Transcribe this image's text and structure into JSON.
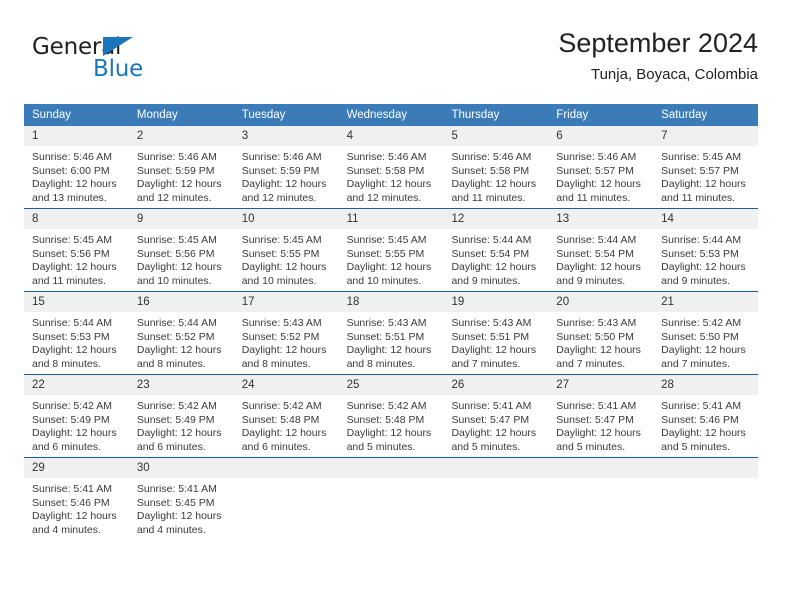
{
  "brand": {
    "name_dark": "General",
    "name_blue": "Blue",
    "accent_color": "#1b75bb"
  },
  "header": {
    "title": "September 2024",
    "subtitle": "Tunja, Boyaca, Colombia"
  },
  "calendar": {
    "header_bg": "#3b7cb8",
    "weekdays": [
      "Sunday",
      "Monday",
      "Tuesday",
      "Wednesday",
      "Thursday",
      "Friday",
      "Saturday"
    ],
    "weeks": [
      [
        {
          "day": "1",
          "sunrise": "Sunrise: 5:46 AM",
          "sunset": "Sunset: 6:00 PM",
          "daylight_1": "Daylight: 12 hours",
          "daylight_2": "and 13 minutes."
        },
        {
          "day": "2",
          "sunrise": "Sunrise: 5:46 AM",
          "sunset": "Sunset: 5:59 PM",
          "daylight_1": "Daylight: 12 hours",
          "daylight_2": "and 12 minutes."
        },
        {
          "day": "3",
          "sunrise": "Sunrise: 5:46 AM",
          "sunset": "Sunset: 5:59 PM",
          "daylight_1": "Daylight: 12 hours",
          "daylight_2": "and 12 minutes."
        },
        {
          "day": "4",
          "sunrise": "Sunrise: 5:46 AM",
          "sunset": "Sunset: 5:58 PM",
          "daylight_1": "Daylight: 12 hours",
          "daylight_2": "and 12 minutes."
        },
        {
          "day": "5",
          "sunrise": "Sunrise: 5:46 AM",
          "sunset": "Sunset: 5:58 PM",
          "daylight_1": "Daylight: 12 hours",
          "daylight_2": "and 11 minutes."
        },
        {
          "day": "6",
          "sunrise": "Sunrise: 5:46 AM",
          "sunset": "Sunset: 5:57 PM",
          "daylight_1": "Daylight: 12 hours",
          "daylight_2": "and 11 minutes."
        },
        {
          "day": "7",
          "sunrise": "Sunrise: 5:45 AM",
          "sunset": "Sunset: 5:57 PM",
          "daylight_1": "Daylight: 12 hours",
          "daylight_2": "and 11 minutes."
        }
      ],
      [
        {
          "day": "8",
          "sunrise": "Sunrise: 5:45 AM",
          "sunset": "Sunset: 5:56 PM",
          "daylight_1": "Daylight: 12 hours",
          "daylight_2": "and 11 minutes."
        },
        {
          "day": "9",
          "sunrise": "Sunrise: 5:45 AM",
          "sunset": "Sunset: 5:56 PM",
          "daylight_1": "Daylight: 12 hours",
          "daylight_2": "and 10 minutes."
        },
        {
          "day": "10",
          "sunrise": "Sunrise: 5:45 AM",
          "sunset": "Sunset: 5:55 PM",
          "daylight_1": "Daylight: 12 hours",
          "daylight_2": "and 10 minutes."
        },
        {
          "day": "11",
          "sunrise": "Sunrise: 5:45 AM",
          "sunset": "Sunset: 5:55 PM",
          "daylight_1": "Daylight: 12 hours",
          "daylight_2": "and 10 minutes."
        },
        {
          "day": "12",
          "sunrise": "Sunrise: 5:44 AM",
          "sunset": "Sunset: 5:54 PM",
          "daylight_1": "Daylight: 12 hours",
          "daylight_2": "and 9 minutes."
        },
        {
          "day": "13",
          "sunrise": "Sunrise: 5:44 AM",
          "sunset": "Sunset: 5:54 PM",
          "daylight_1": "Daylight: 12 hours",
          "daylight_2": "and 9 minutes."
        },
        {
          "day": "14",
          "sunrise": "Sunrise: 5:44 AM",
          "sunset": "Sunset: 5:53 PM",
          "daylight_1": "Daylight: 12 hours",
          "daylight_2": "and 9 minutes."
        }
      ],
      [
        {
          "day": "15",
          "sunrise": "Sunrise: 5:44 AM",
          "sunset": "Sunset: 5:53 PM",
          "daylight_1": "Daylight: 12 hours",
          "daylight_2": "and 8 minutes."
        },
        {
          "day": "16",
          "sunrise": "Sunrise: 5:44 AM",
          "sunset": "Sunset: 5:52 PM",
          "daylight_1": "Daylight: 12 hours",
          "daylight_2": "and 8 minutes."
        },
        {
          "day": "17",
          "sunrise": "Sunrise: 5:43 AM",
          "sunset": "Sunset: 5:52 PM",
          "daylight_1": "Daylight: 12 hours",
          "daylight_2": "and 8 minutes."
        },
        {
          "day": "18",
          "sunrise": "Sunrise: 5:43 AM",
          "sunset": "Sunset: 5:51 PM",
          "daylight_1": "Daylight: 12 hours",
          "daylight_2": "and 8 minutes."
        },
        {
          "day": "19",
          "sunrise": "Sunrise: 5:43 AM",
          "sunset": "Sunset: 5:51 PM",
          "daylight_1": "Daylight: 12 hours",
          "daylight_2": "and 7 minutes."
        },
        {
          "day": "20",
          "sunrise": "Sunrise: 5:43 AM",
          "sunset": "Sunset: 5:50 PM",
          "daylight_1": "Daylight: 12 hours",
          "daylight_2": "and 7 minutes."
        },
        {
          "day": "21",
          "sunrise": "Sunrise: 5:42 AM",
          "sunset": "Sunset: 5:50 PM",
          "daylight_1": "Daylight: 12 hours",
          "daylight_2": "and 7 minutes."
        }
      ],
      [
        {
          "day": "22",
          "sunrise": "Sunrise: 5:42 AM",
          "sunset": "Sunset: 5:49 PM",
          "daylight_1": "Daylight: 12 hours",
          "daylight_2": "and 6 minutes."
        },
        {
          "day": "23",
          "sunrise": "Sunrise: 5:42 AM",
          "sunset": "Sunset: 5:49 PM",
          "daylight_1": "Daylight: 12 hours",
          "daylight_2": "and 6 minutes."
        },
        {
          "day": "24",
          "sunrise": "Sunrise: 5:42 AM",
          "sunset": "Sunset: 5:48 PM",
          "daylight_1": "Daylight: 12 hours",
          "daylight_2": "and 6 minutes."
        },
        {
          "day": "25",
          "sunrise": "Sunrise: 5:42 AM",
          "sunset": "Sunset: 5:48 PM",
          "daylight_1": "Daylight: 12 hours",
          "daylight_2": "and 5 minutes."
        },
        {
          "day": "26",
          "sunrise": "Sunrise: 5:41 AM",
          "sunset": "Sunset: 5:47 PM",
          "daylight_1": "Daylight: 12 hours",
          "daylight_2": "and 5 minutes."
        },
        {
          "day": "27",
          "sunrise": "Sunrise: 5:41 AM",
          "sunset": "Sunset: 5:47 PM",
          "daylight_1": "Daylight: 12 hours",
          "daylight_2": "and 5 minutes."
        },
        {
          "day": "28",
          "sunrise": "Sunrise: 5:41 AM",
          "sunset": "Sunset: 5:46 PM",
          "daylight_1": "Daylight: 12 hours",
          "daylight_2": "and 5 minutes."
        }
      ],
      [
        {
          "day": "29",
          "sunrise": "Sunrise: 5:41 AM",
          "sunset": "Sunset: 5:46 PM",
          "daylight_1": "Daylight: 12 hours",
          "daylight_2": "and 4 minutes."
        },
        {
          "day": "30",
          "sunrise": "Sunrise: 5:41 AM",
          "sunset": "Sunset: 5:45 PM",
          "daylight_1": "Daylight: 12 hours",
          "daylight_2": "and 4 minutes."
        },
        {
          "day": "",
          "sunrise": "",
          "sunset": "",
          "daylight_1": "",
          "daylight_2": ""
        },
        {
          "day": "",
          "sunrise": "",
          "sunset": "",
          "daylight_1": "",
          "daylight_2": ""
        },
        {
          "day": "",
          "sunrise": "",
          "sunset": "",
          "daylight_1": "",
          "daylight_2": ""
        },
        {
          "day": "",
          "sunrise": "",
          "sunset": "",
          "daylight_1": "",
          "daylight_2": ""
        },
        {
          "day": "",
          "sunrise": "",
          "sunset": "",
          "daylight_1": "",
          "daylight_2": ""
        }
      ]
    ]
  }
}
